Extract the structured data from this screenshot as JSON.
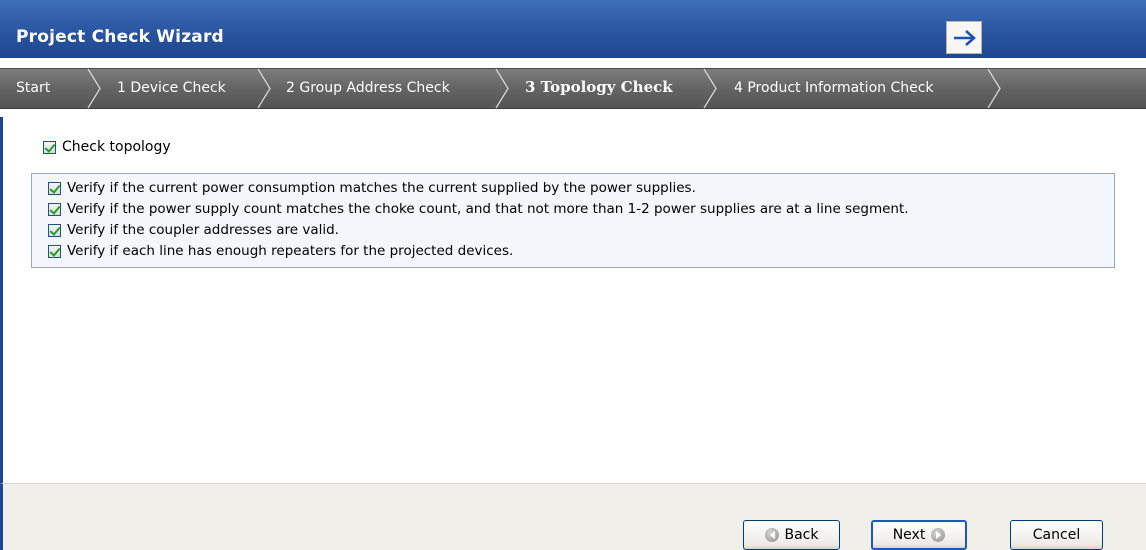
{
  "window": {
    "title": "Project Check Wizard"
  },
  "breadcrumbs": [
    {
      "label": "Start"
    },
    {
      "label": "1 Device Check"
    },
    {
      "label": "2 Group Address Check"
    },
    {
      "label": "3 Topology Check",
      "active": true
    },
    {
      "label": "4 Product Information Check"
    }
  ],
  "main": {
    "check_topology": {
      "label": "Check topology",
      "checked": true
    },
    "options": [
      {
        "label": "Verify if the current power consumption matches the current supplied by the power supplies.",
        "checked": true
      },
      {
        "label": "Verify if the power supply count matches the choke count, and that not more than 1-2 power supplies are at a line segment.",
        "checked": true
      },
      {
        "label": "Verify if the coupler addresses are valid.",
        "checked": true
      },
      {
        "label": "Verify if each line has enough repeaters for the projected devices.",
        "checked": true
      }
    ]
  },
  "footer": {
    "back_label": "Back",
    "next_label": "Next",
    "cancel_label": "Cancel"
  },
  "colors": {
    "title_bar": "#2a55a0",
    "breadcrumb_bar": "#646464",
    "footer_bg": "#f0efe9"
  },
  "icons": {
    "nav": "arrow-right-icon",
    "back": "circle-left-icon",
    "next": "circle-right-icon",
    "check": "checkmark-icon"
  }
}
